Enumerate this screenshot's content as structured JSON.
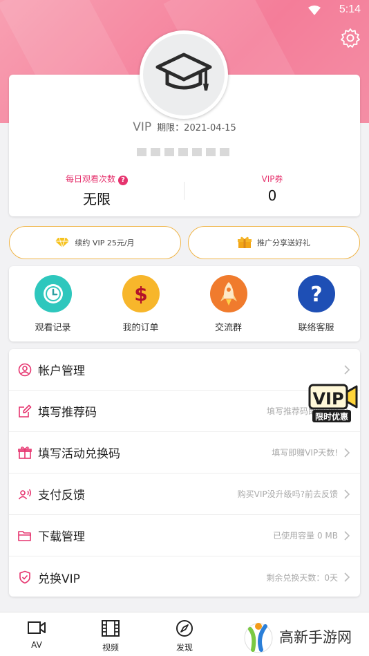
{
  "status": {
    "time": "5:14"
  },
  "profile": {
    "vip_text": "VIP",
    "expiry_label": "期限：",
    "expiry_date": "2021-04-15",
    "daily_label": "每日观看次数",
    "daily_value": "无限",
    "coupon_label": "VIP券",
    "coupon_value": "0"
  },
  "pills": {
    "renew": "续约 VIP 25元/月",
    "share": "推广分享送好礼"
  },
  "quick": [
    {
      "label": "观看记录",
      "icon": "clock-icon",
      "color": "#2ec7bd"
    },
    {
      "label": "我的订单",
      "icon": "dollar-icon",
      "color": "#f7b62b"
    },
    {
      "label": "交流群",
      "icon": "rocket-icon",
      "color": "#f07b2d"
    },
    {
      "label": "联络客服",
      "icon": "help-icon",
      "color": "#1e4fb5"
    }
  ],
  "menu": [
    {
      "label": "帐户管理",
      "hint": "",
      "icon": "user-icon"
    },
    {
      "label": "填写推荐码",
      "hint": "填写推荐码即赠VIP",
      "icon": "edit-icon"
    },
    {
      "label": "填写活动兑换码",
      "hint": "填写即赠VIP天数!",
      "icon": "gift-icon"
    },
    {
      "label": "支付反馈",
      "hint": "购买VIP没升级吗?前去反馈",
      "icon": "feedback-icon"
    },
    {
      "label": "下载管理",
      "hint": "已使用容量 0 MB",
      "icon": "folder-icon"
    },
    {
      "label": "兑换VIP",
      "hint": "剩余兑换天数：0天",
      "icon": "shield-icon"
    }
  ],
  "promo": {
    "top": "VIP",
    "bottom": "限时优惠"
  },
  "tabs": [
    {
      "label": "AV",
      "icon": "camera-icon"
    },
    {
      "label": "视频",
      "icon": "film-icon"
    },
    {
      "label": "发现",
      "icon": "compass-icon"
    }
  ],
  "watermark": {
    "text": "高新手游网"
  },
  "colors": {
    "accent": "#e6336e",
    "header": "#f47d99",
    "pill_border": "#f0b548"
  }
}
